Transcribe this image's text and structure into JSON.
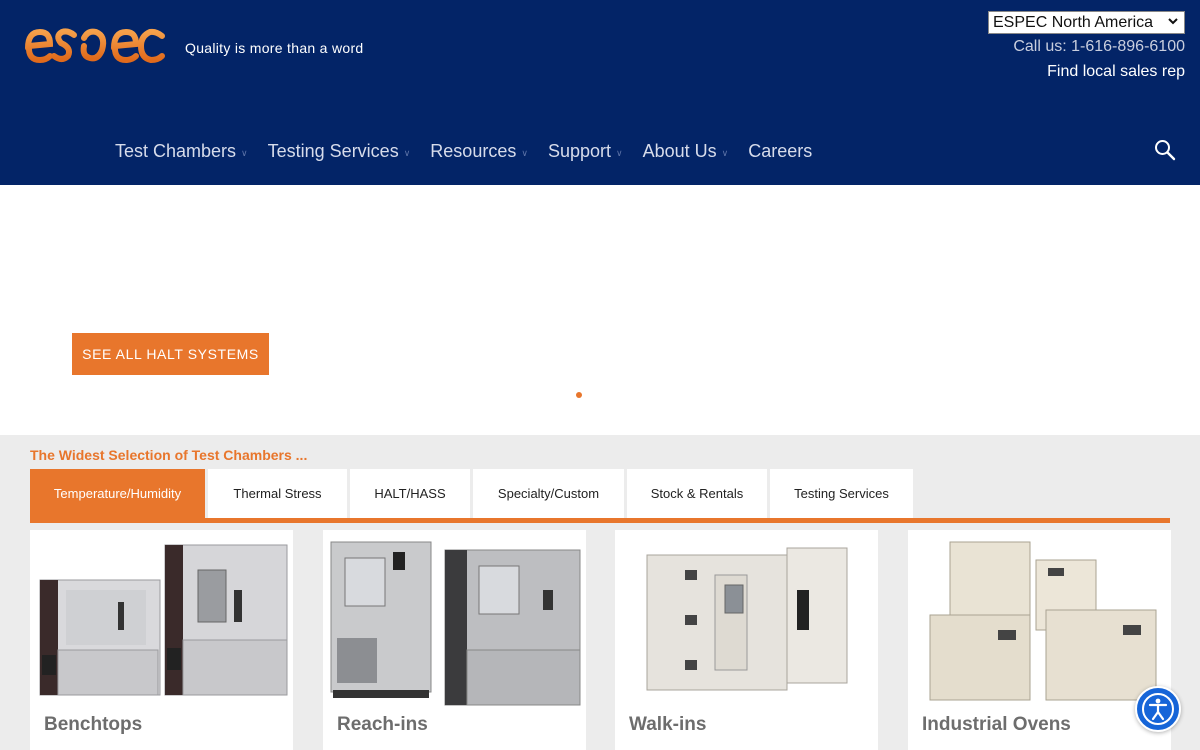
{
  "header": {
    "logo_text": "ESPEC",
    "tagline": "Quality is more than a word",
    "region_select": "ESPEC North America",
    "call_us": "Call us: 1-616-896-6100",
    "find_sales_rep": "Find local sales rep",
    "nav": [
      {
        "label": "Test Chambers",
        "has_dropdown": true
      },
      {
        "label": "Testing Services",
        "has_dropdown": true
      },
      {
        "label": "Resources",
        "has_dropdown": true
      },
      {
        "label": "Support",
        "has_dropdown": true
      },
      {
        "label": "About Us",
        "has_dropdown": true
      },
      {
        "label": "Careers",
        "has_dropdown": false
      }
    ],
    "search_icon": "search-icon"
  },
  "hero": {
    "cta_label": "SEE ALL HALT SYSTEMS"
  },
  "products": {
    "title": "The Widest Selection of Test Chambers ...",
    "tabs": [
      {
        "label": "Temperature/Humidity",
        "active": true
      },
      {
        "label": "Thermal Stress",
        "active": false
      },
      {
        "label": "HALT/HASS",
        "active": false
      },
      {
        "label": "Specialty/Custom",
        "active": false
      },
      {
        "label": "Stock & Rentals",
        "active": false
      },
      {
        "label": "Testing Services",
        "active": false
      }
    ],
    "cards": [
      {
        "label": "Benchtops"
      },
      {
        "label": "Reach-ins"
      },
      {
        "label": "Walk-ins"
      },
      {
        "label": "Industrial Ovens"
      }
    ]
  },
  "colors": {
    "header_bg": "#032467",
    "accent": "#e8762c",
    "section_bg": "#ececec",
    "accessibility_button": "#1665d8"
  }
}
